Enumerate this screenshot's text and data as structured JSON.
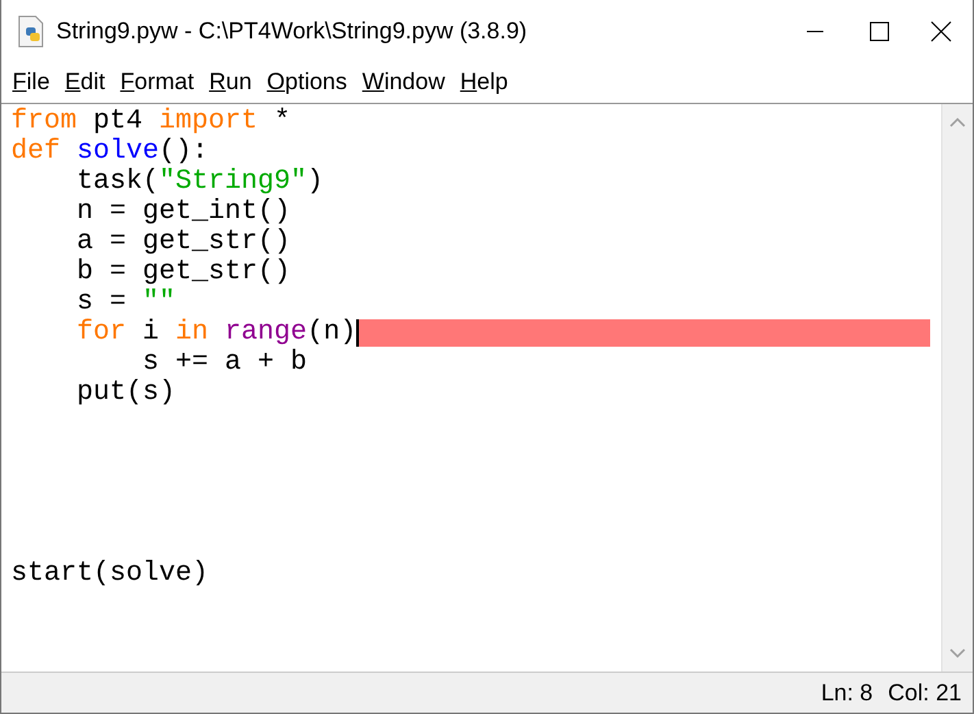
{
  "window": {
    "title": "String9.pyw - C:\\PT4Work\\String9.pyw (3.8.9)"
  },
  "menu": [
    {
      "label": "File"
    },
    {
      "label": "Edit"
    },
    {
      "label": "Format"
    },
    {
      "label": "Run"
    },
    {
      "label": "Options"
    },
    {
      "label": "Window"
    },
    {
      "label": "Help"
    }
  ],
  "editor": {
    "lines": [
      {
        "kind": "code",
        "error": false,
        "tokens": [
          {
            "text": "from",
            "kind": "keyword"
          },
          {
            "text": " pt4 ",
            "kind": "plain"
          },
          {
            "text": "import",
            "kind": "keyword"
          },
          {
            "text": " *",
            "kind": "plain"
          }
        ]
      },
      {
        "kind": "code",
        "error": false,
        "tokens": [
          {
            "text": "def",
            "kind": "keyword"
          },
          {
            "text": " solve",
            "kind": "definition"
          },
          {
            "text": "():",
            "kind": "plain"
          }
        ],
        "children": [
          {
            "kind": "code",
            "error": false,
            "tokens": [
              {
                "text": "task(",
                "kind": "plain"
              },
              {
                "text": "\"String9\"",
                "kind": "string"
              },
              {
                "text": ")",
                "kind": "plain"
              }
            ]
          },
          {
            "kind": "code",
            "error": false,
            "tokens": [
              {
                "text": "n = get_int()",
                "kind": "plain"
              }
            ]
          },
          {
            "kind": "code",
            "error": false,
            "tokens": [
              {
                "text": "a = get_str()",
                "kind": "plain"
              }
            ]
          },
          {
            "kind": "code",
            "error": false,
            "tokens": [
              {
                "text": "b = get_str()",
                "kind": "plain"
              }
            ]
          },
          {
            "kind": "code",
            "error": false,
            "tokens": [
              {
                "text": "s = ",
                "kind": "plain"
              },
              {
                "text": "\"\"",
                "kind": "string"
              }
            ]
          },
          {
            "kind": "code",
            "error": true,
            "tokens": [
              {
                "text": "for",
                "kind": "keyword"
              },
              {
                "text": " i ",
                "kind": "plain"
              },
              {
                "text": "in",
                "kind": "keyword"
              },
              {
                "text": " range",
                "kind": "builtin"
              },
              {
                "text": "(n)",
                "kind": "plain"
              }
            ],
            "children": [
              {
                "kind": "code",
                "error": false,
                "tokens": [
                  {
                    "text": "s += a + b",
                    "kind": "plain"
                  }
                ]
              }
            ]
          },
          {
            "kind": "code",
            "error": false,
            "tokens": [
              {
                "text": "put(s)",
                "kind": "plain"
              }
            ]
          }
        ]
      },
      {
        "kind": "blank"
      },
      {
        "kind": "blank"
      },
      {
        "kind": "blank"
      },
      {
        "kind": "blank"
      },
      {
        "kind": "blank"
      },
      {
        "kind": "code",
        "error": false,
        "tokens": [
          {
            "text": "start(solve)",
            "kind": "plain"
          }
        ]
      }
    ]
  },
  "status_bar": {
    "line": "Ln: 8",
    "column": "Col: 21"
  }
}
